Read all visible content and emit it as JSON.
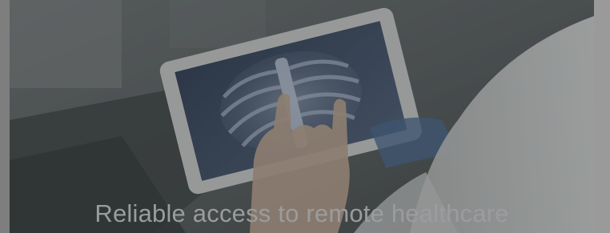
{
  "hero": {
    "caption": "Reliable access to remote healthcare",
    "image_subject": "hand-tapping-tablet-xray",
    "colors": {
      "overlay": "#4f5354",
      "caption_text": "#9a9c9e",
      "sleeve": "#e4e4e4",
      "xray_screen": "#3b4a63"
    }
  }
}
